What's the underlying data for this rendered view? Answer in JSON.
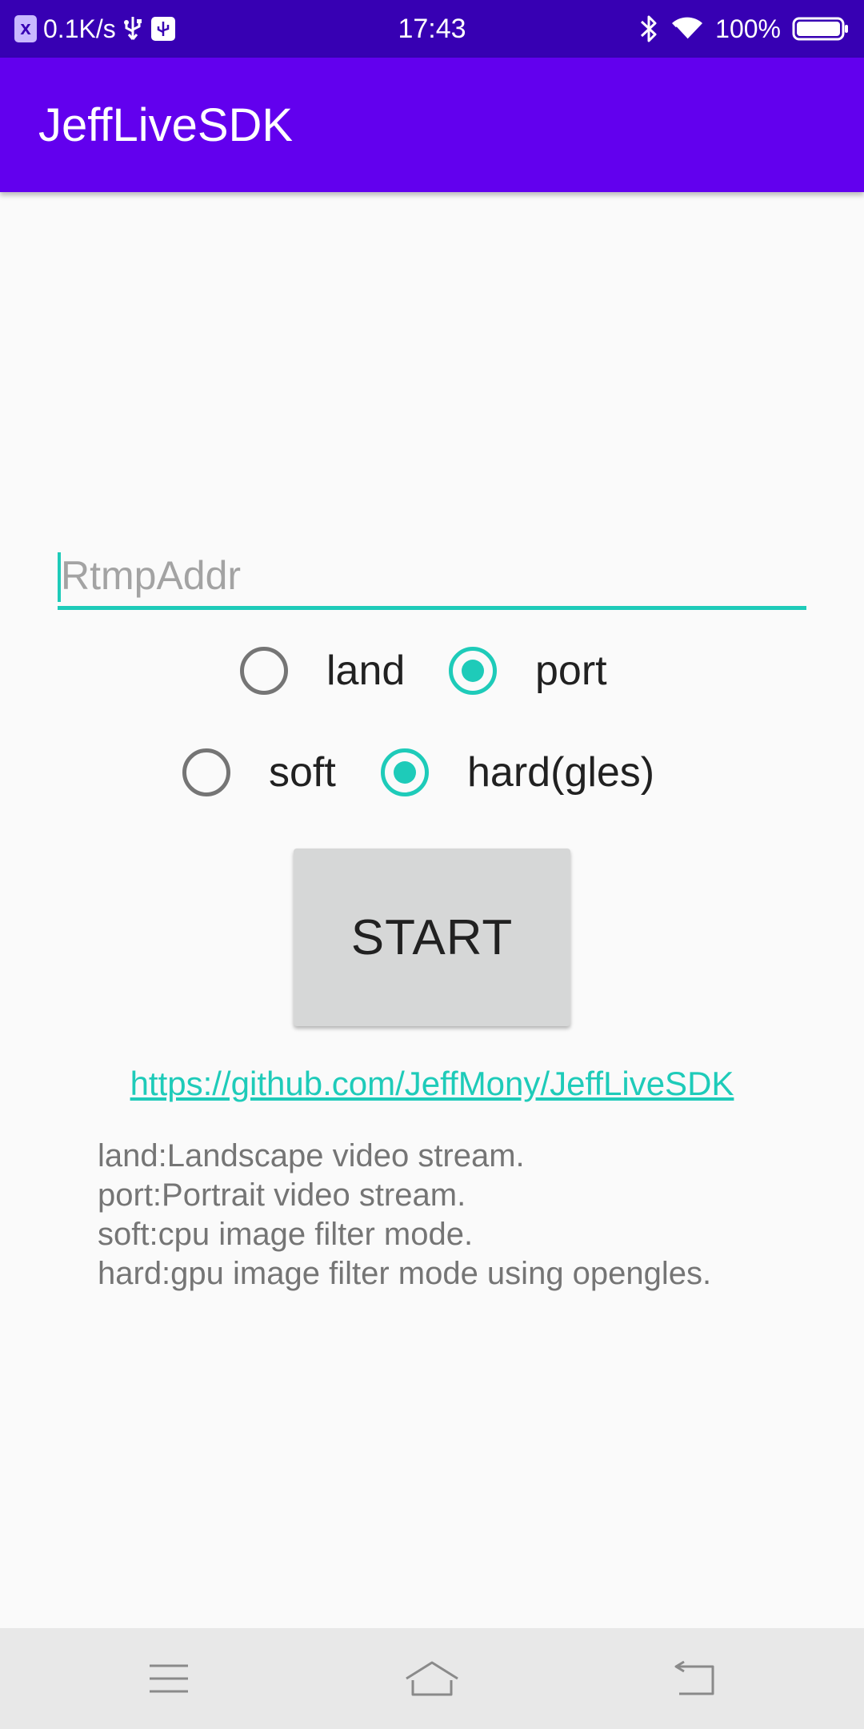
{
  "status_bar": {
    "badge": "x",
    "net_speed": "0.1K/s",
    "time": "17:43",
    "battery": "100%",
    "icons": [
      "close-badge-icon",
      "usb-icon",
      "usb-debug-icon",
      "bluetooth-icon",
      "wifi-icon",
      "battery-icon"
    ]
  },
  "app_bar": {
    "title": "JeffLiveSDK"
  },
  "form": {
    "rtmp_placeholder": "RtmpAddr",
    "rtmp_value": "",
    "orientation": {
      "options": [
        {
          "label": "land",
          "checked": false
        },
        {
          "label": "port",
          "checked": true
        }
      ]
    },
    "filter_mode": {
      "options": [
        {
          "label": "soft",
          "checked": false
        },
        {
          "label": "hard(gles)",
          "checked": true
        }
      ]
    },
    "start_label": "START"
  },
  "link": {
    "text": "https://github.com/JeffMony/JeffLiveSDK"
  },
  "description": [
    "land:Landscape video stream.",
    "port:Portrait video stream.",
    "soft:cpu image filter mode.",
    "hard:gpu image filter mode using opengles."
  ],
  "nav_bar": {
    "icons": [
      "menu-icon",
      "home-icon",
      "back-icon"
    ]
  },
  "colors": {
    "status_bar": "#3700b3",
    "app_bar": "#6200ee",
    "accent": "#1ecbb9",
    "background": "#fafafa",
    "button": "#d6d7d7"
  }
}
